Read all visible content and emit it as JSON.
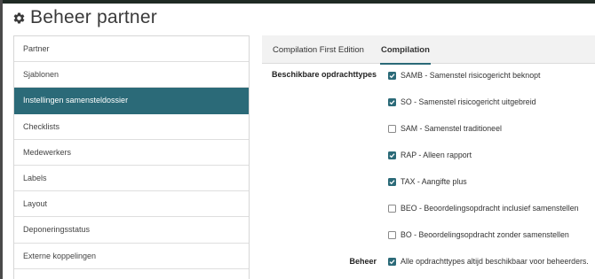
{
  "page": {
    "title": "Beheer partner",
    "title_icon": "gear-icon"
  },
  "sidebar": {
    "active_index": 2,
    "items": [
      {
        "label": "Partner"
      },
      {
        "label": "Sjablonen"
      },
      {
        "label": "Instellingen samensteldossier"
      },
      {
        "label": "Checklists"
      },
      {
        "label": "Medewerkers"
      },
      {
        "label": "Labels"
      },
      {
        "label": "Layout"
      },
      {
        "label": "Deponeringsstatus"
      },
      {
        "label": "Externe koppelingen"
      }
    ]
  },
  "tabs": [
    {
      "label": "Compilation First Edition",
      "active": false
    },
    {
      "label": "Compilation",
      "active": true
    }
  ],
  "form": {
    "opdrachttypes_label": "Beschikbare opdrachttypes",
    "opdrachttypes": [
      {
        "label": "SAMB - Samenstel risicogericht beknopt",
        "checked": true
      },
      {
        "label": "SO - Samenstel risicogericht uitgebreid",
        "checked": true
      },
      {
        "label": "SAM - Samenstel traditioneel",
        "checked": false
      },
      {
        "label": "RAP - Alleen rapport",
        "checked": true
      },
      {
        "label": "TAX - Aangifte plus",
        "checked": true
      },
      {
        "label": "BEO - Beoordelingsopdracht inclusief samenstellen",
        "checked": false
      },
      {
        "label": "BO - Beoordelingsopdracht zonder samenstellen",
        "checked": false
      }
    ],
    "beheer_label": "Beheer",
    "beheer_option": {
      "label": "Alle opdrachttypes altijd beschikbaar voor beheerders.",
      "checked": true
    }
  },
  "colors": {
    "accent": "#2b6a78",
    "tabbar_bg": "#f2f2f2",
    "border": "#d7d7d7"
  }
}
